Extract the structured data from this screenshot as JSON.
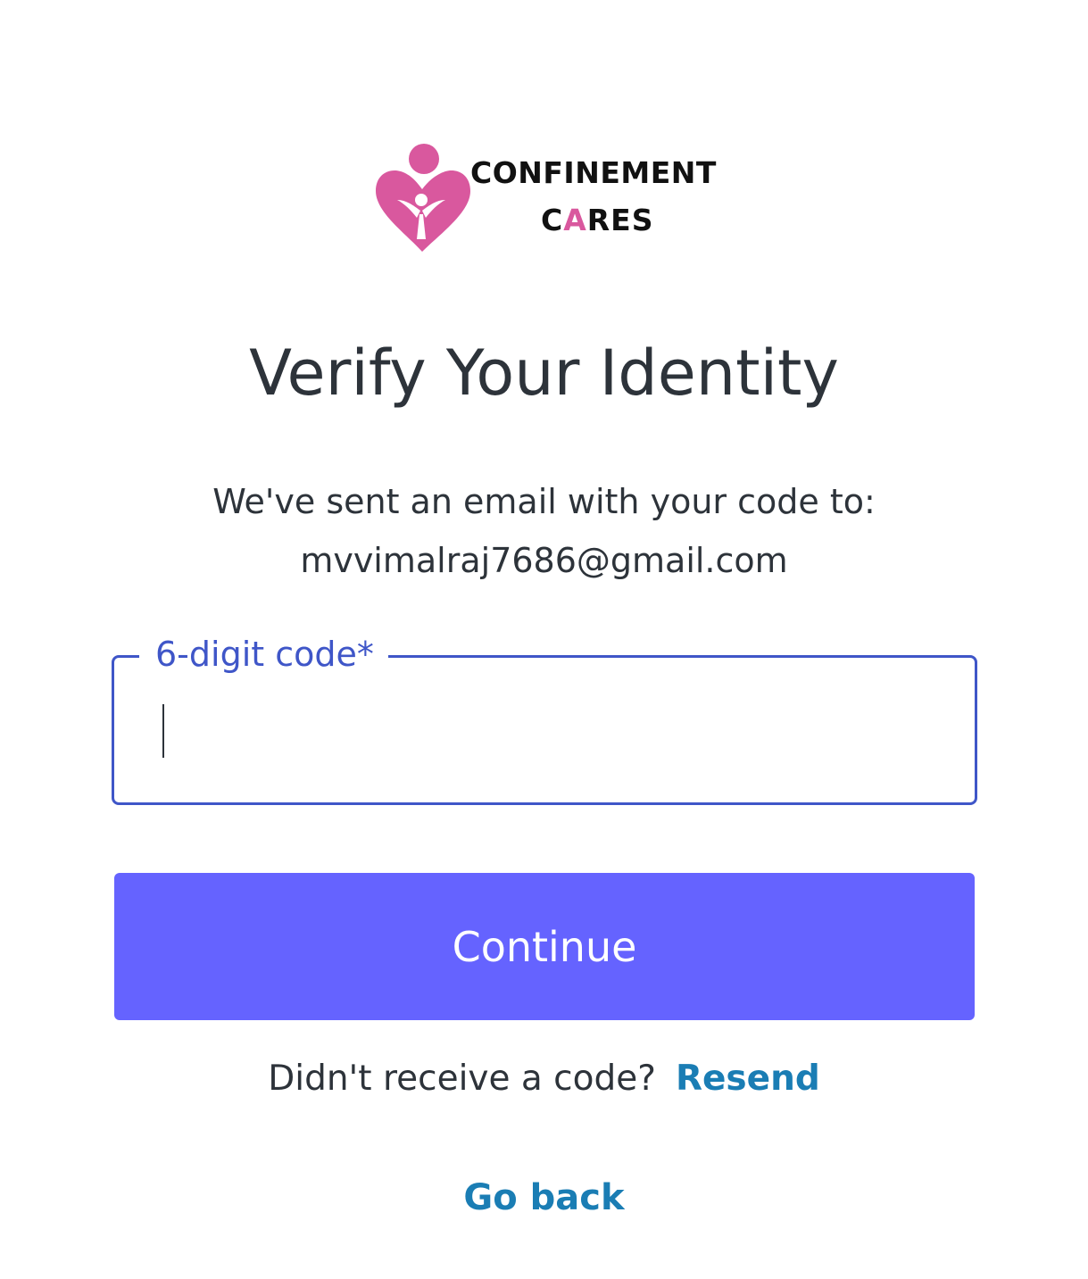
{
  "brand": {
    "line1": "CONFINEMENT",
    "line2_start": "C",
    "line2_accent": "A",
    "line2_end": "RES",
    "accent_color": "#d9589e",
    "logo_icon": "mother-child-heart-icon"
  },
  "page": {
    "title": "Verify Your Identity",
    "subtitle": "We've sent an email with your code to:",
    "email": "mvvimalraj7686@gmail.com"
  },
  "code_field": {
    "label": "6-digit code*",
    "value": "",
    "placeholder": "",
    "border_color": "#3f56c8"
  },
  "actions": {
    "continue_label": "Continue",
    "continue_color": "#6563ff",
    "resend_prompt": "Didn't receive a code?",
    "resend_label": "Resend",
    "go_back_label": "Go back",
    "link_color": "#1a7db4"
  }
}
